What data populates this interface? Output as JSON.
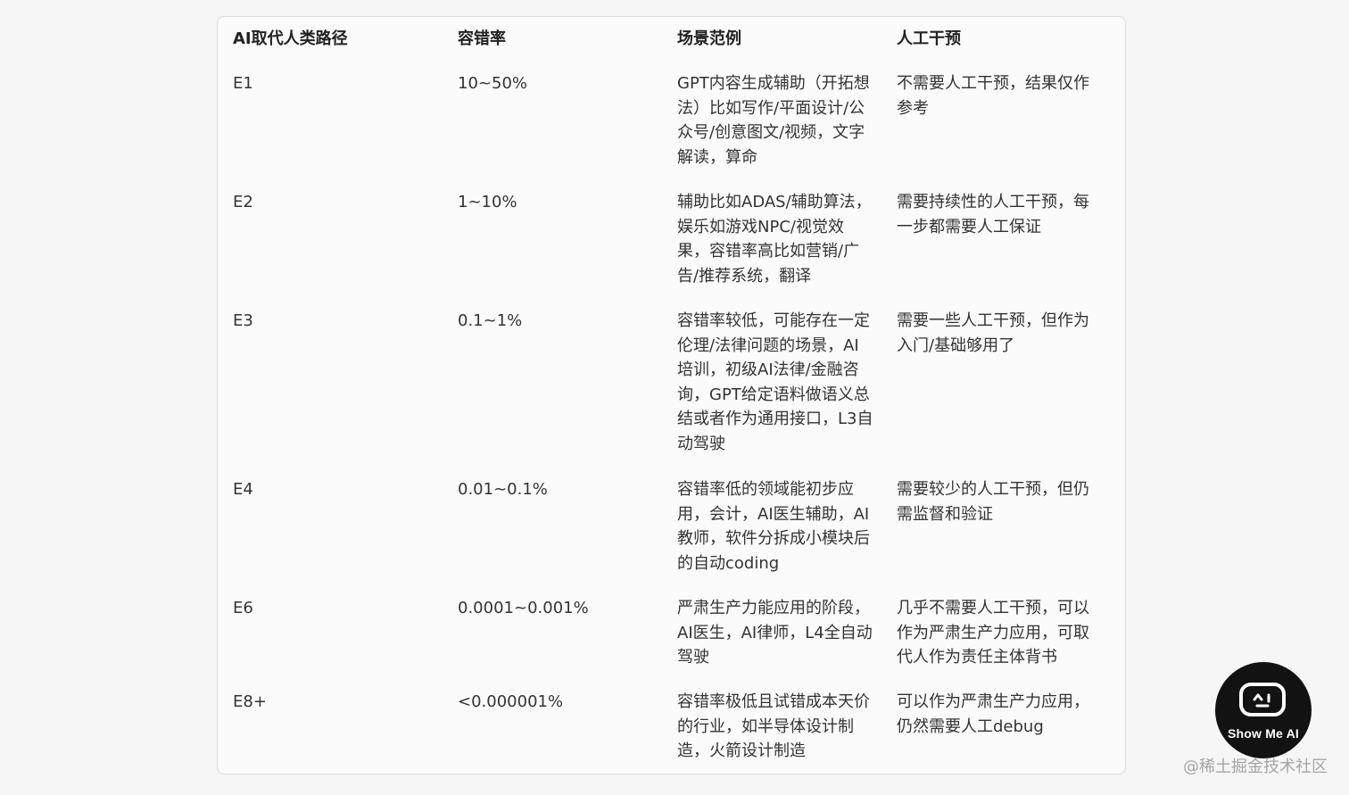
{
  "table": {
    "headers": [
      "AI取代人类路径",
      "容错率",
      "场景范例",
      "人工干预"
    ],
    "rows": [
      {
        "path": "E1",
        "tolerance": "10~50%",
        "scenarios": [
          "GPT内容生成辅助（开拓想",
          "法）比如写作/平面设计/公",
          "众号/创意图文/视频，文字",
          "解读，算命"
        ],
        "intervention": [
          "不需要人工干预，结果仅作",
          "参考"
        ]
      },
      {
        "path": "E2",
        "tolerance": "1~10%",
        "scenarios": [
          "辅助比如ADAS/辅助算法，",
          "娱乐如游戏NPC/视觉效",
          "果，容错率高比如营销/广",
          "告/推荐系统，翻译"
        ],
        "intervention": [
          "需要持续性的人工干预，每",
          "一步都需要人工保证"
        ]
      },
      {
        "path": "E3",
        "tolerance": "0.1~1%",
        "scenarios": [
          "容错率较低，可能存在一定",
          "伦理/法律问题的场景，AI",
          "培训，初级AI法律/金融咨",
          "询，GPT给定语料做语义总",
          "结或者作为通用接口，L3自",
          "动驾驶"
        ],
        "intervention": [
          "需要一些人工干预，但作为",
          "入门/基础够用了"
        ]
      },
      {
        "path": "E4",
        "tolerance": "0.01~0.1%",
        "scenarios": [
          "容错率低的领域能初步应",
          "用，会计，AI医生辅助，AI",
          "教师，软件分拆成小模块后",
          "的自动coding"
        ],
        "intervention": [
          "需要较少的人工干预，但仍",
          "需监督和验证"
        ]
      },
      {
        "path": "E6",
        "tolerance": "0.0001~0.001%",
        "scenarios": [
          "严肃生产力能应用的阶段，",
          "AI医生，AI律师，L4全自动",
          "驾驶"
        ],
        "intervention": [
          "几乎不需要人工干预，可以",
          "作为严肃生产力应用，可取",
          "代人作为责任主体背书"
        ]
      },
      {
        "path": "E8+",
        "tolerance": "<0.000001%",
        "scenarios": [
          "容错率极低且试错成本天价",
          "的行业，如半导体设计制",
          "造，火箭设计制造"
        ],
        "intervention": [
          "可以作为严肃生产力应用，",
          "仍然需要人工debug"
        ]
      }
    ]
  },
  "logo": {
    "text": "Show Me AI",
    "icon": "robot-face-icon"
  },
  "watermark": "@稀土掘金技术社区"
}
